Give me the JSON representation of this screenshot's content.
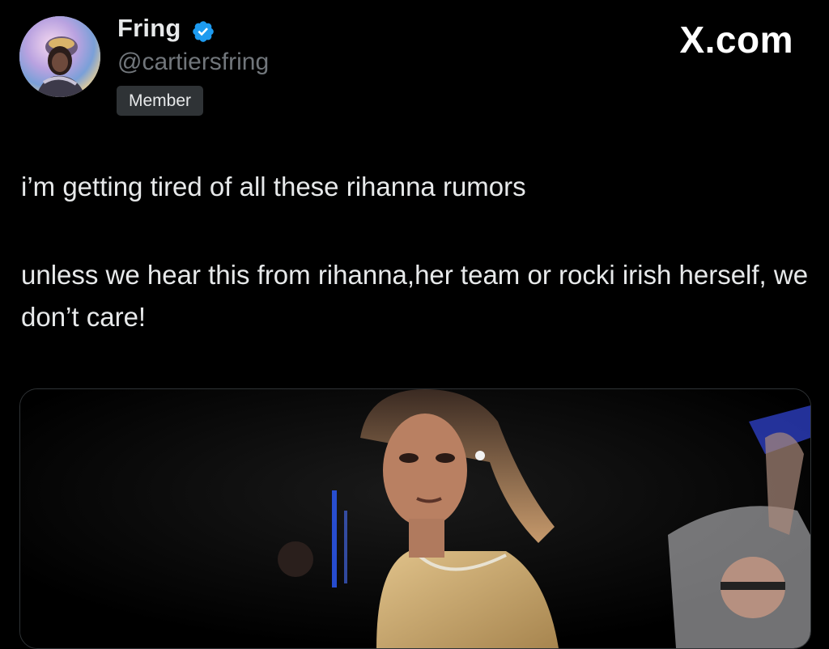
{
  "author": {
    "display_name": "Fring",
    "handle": "@cartiersfring",
    "badge": "Member",
    "verified": true,
    "verified_color": "#1d9bf0"
  },
  "site": {
    "logo": "X.com"
  },
  "tweet": {
    "paragraphs": [
      "i’m getting tired of all these rihanna rumors",
      "unless we hear this from rihanna,her team or rocki irish herself, we don’t care!"
    ]
  },
  "media": {
    "type": "gif-image"
  },
  "colors": {
    "background": "#000000",
    "text": "#e7e9ea",
    "secondary_text": "#71767b",
    "badge_bg": "#2f3336"
  }
}
